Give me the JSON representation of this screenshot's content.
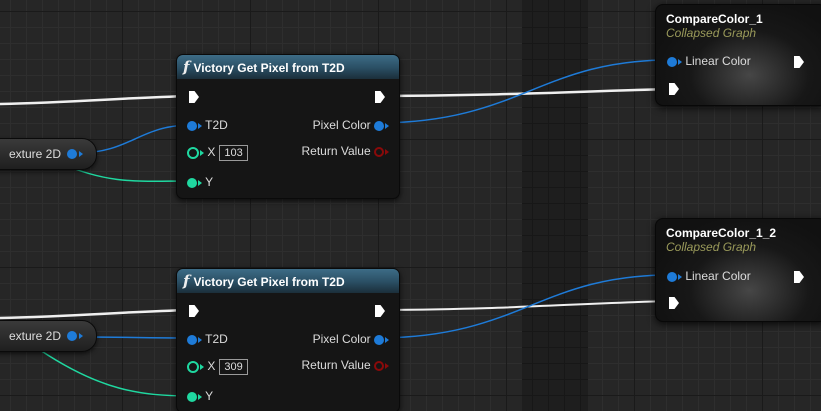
{
  "nodes": [
    {
      "title": "Victory Get Pixel from T2D",
      "in_t2d": "T2D",
      "in_x": "X",
      "x_value": "103",
      "in_y": "Y",
      "out_pixel": "Pixel Color",
      "out_return": "Return Value"
    },
    {
      "title": "Victory Get Pixel from T2D",
      "in_t2d": "T2D",
      "in_x": "X",
      "x_value": "309",
      "in_y": "Y",
      "out_pixel": "Pixel Color",
      "out_return": "Return Value"
    }
  ],
  "variables": [
    {
      "label": "exture 2D"
    },
    {
      "label": "exture 2D"
    }
  ],
  "collapsed_graphs": [
    {
      "title": "CompareColor_1",
      "subtitle": "Collapsed Graph",
      "pin": "Linear Color"
    },
    {
      "title": "CompareColor_1_2",
      "subtitle": "Collapsed Graph",
      "pin": "Linear Color"
    }
  ],
  "icons": {
    "function": "f"
  },
  "colors": {
    "exec_wire": "#ffffff",
    "color_pin": "#1e7bd8",
    "int_pin": "#1fd8a0",
    "bool_pin": "#8a0a0a",
    "header": "#2f5a70"
  }
}
